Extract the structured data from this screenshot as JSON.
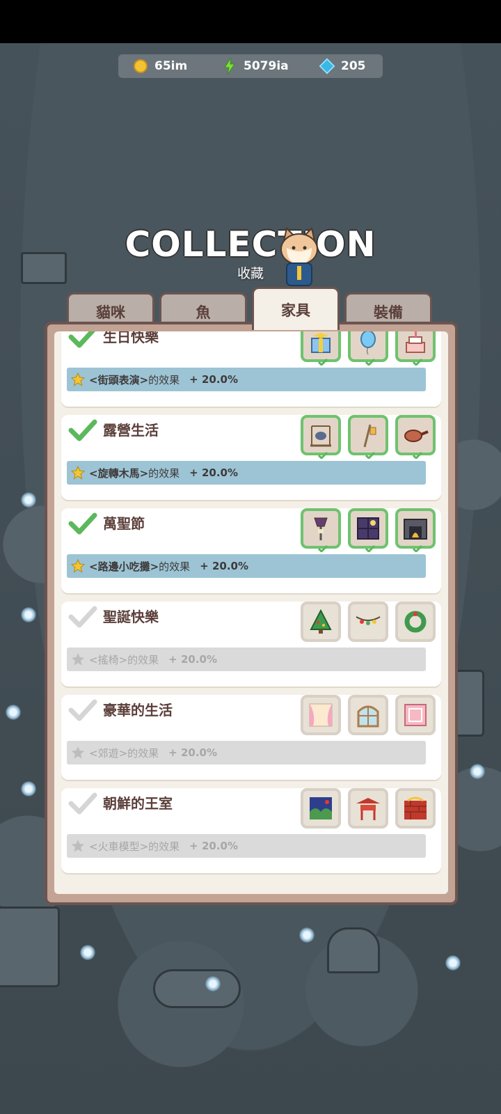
{
  "resources": {
    "coins": {
      "icon": "coin-icon",
      "value": "65im"
    },
    "energy": {
      "icon": "lightning-icon",
      "value": "5079ia"
    },
    "gems": {
      "icon": "gem-icon",
      "value": "205"
    }
  },
  "header": {
    "title": "COLLECTION",
    "subtitle": "收藏"
  },
  "tabs": [
    {
      "label": "貓咪",
      "active": false
    },
    {
      "label": "魚",
      "active": false
    },
    {
      "label": "家具",
      "active": true
    },
    {
      "label": "裝備",
      "active": false
    }
  ],
  "sets": [
    {
      "name": "生日快樂",
      "completed": true,
      "effect_target": "<街頭表演>",
      "effect_suffix": "的效果",
      "bonus": "+ 20.0%",
      "items": [
        "gift-box-icon",
        "balloon-icon",
        "birthday-cake-icon"
      ]
    },
    {
      "name": "露營生活",
      "completed": true,
      "effect_target": "<旋轉木馬>",
      "effect_suffix": "的效果",
      "bonus": "+ 20.0%",
      "items": [
        "campfire-pot-icon",
        "lantern-pole-icon",
        "frying-pan-icon"
      ]
    },
    {
      "name": "萬聖節",
      "completed": true,
      "effect_target": "<路邊小吃攤>",
      "effect_suffix": "的效果",
      "bonus": "+ 20.0%",
      "items": [
        "street-lamp-icon",
        "haunted-window-icon",
        "fireplace-icon"
      ]
    },
    {
      "name": "聖誕快樂",
      "completed": false,
      "effect_target": "<搖椅>",
      "effect_suffix": "的效果",
      "bonus": "+ 20.0%",
      "items": [
        "christmas-tree-icon",
        "string-lights-icon",
        "wreath-icon"
      ]
    },
    {
      "name": "豪華的生活",
      "completed": false,
      "effect_target": "<郊遊>",
      "effect_suffix": "的效果",
      "bonus": "+ 20.0%",
      "items": [
        "curtain-icon",
        "arched-window-icon",
        "pink-rug-icon"
      ]
    },
    {
      "name": "朝鮮的王室",
      "completed": false,
      "effect_target": "<火車模型>",
      "effect_suffix": "的效果",
      "bonus": "+ 20.0%",
      "items": [
        "folding-screen-icon",
        "pavilion-icon",
        "red-brick-wall-icon"
      ]
    }
  ],
  "colors": {
    "completed_border": "#6fc26f",
    "completed_effect": "#9cc4d4",
    "locked_effect": "#dadada",
    "text": "#5b3f3a"
  }
}
